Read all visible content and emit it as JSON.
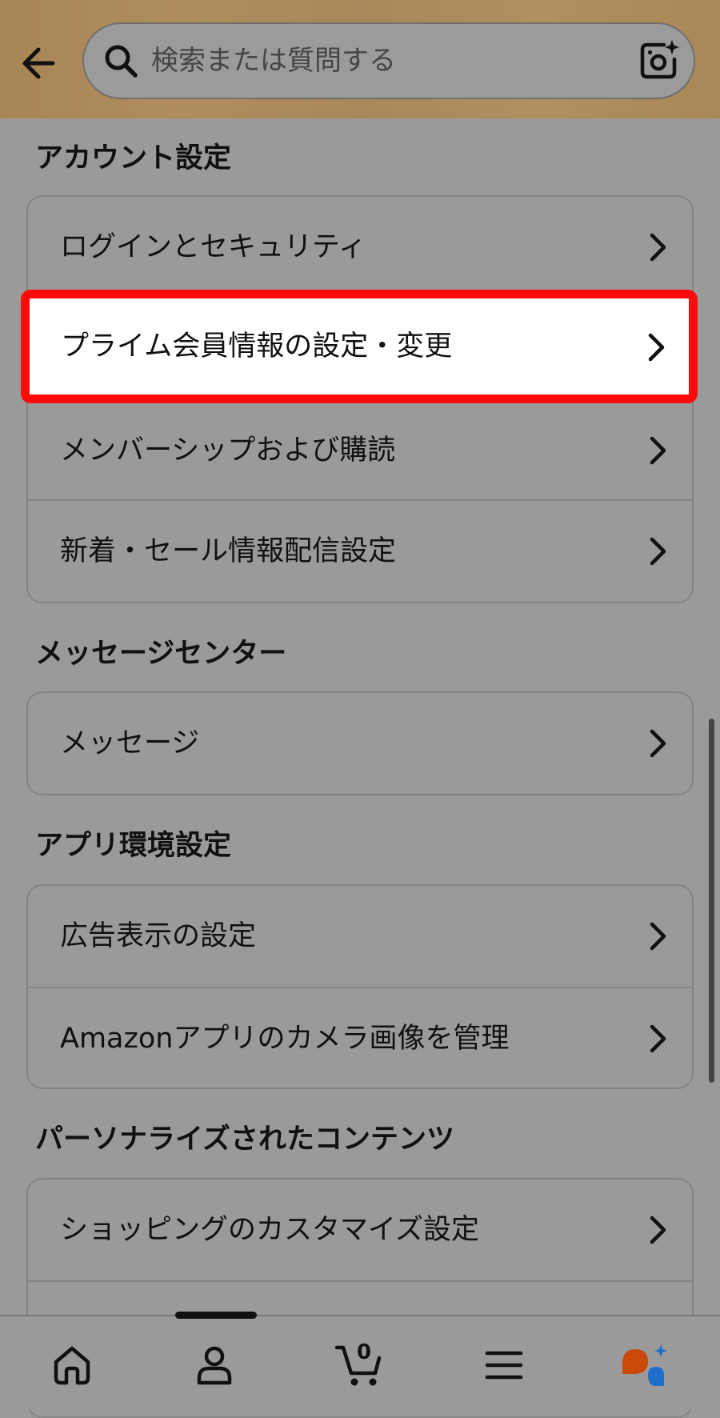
{
  "header": {
    "search": {
      "placeholder": "検索または質問する"
    }
  },
  "sections": [
    {
      "title": "アカウント設定",
      "items": [
        "ログインとセキュリティ",
        "プライム会員情報の設定・変更",
        "メンバーシップおよび購読",
        "新着・セール情報配信設定"
      ]
    },
    {
      "title": "メッセージセンター",
      "items": [
        "メッセージ"
      ]
    },
    {
      "title": "アプリ環境設定",
      "items": [
        "広告表示の設定",
        "Amazonアプリのカメラ画像を管理"
      ]
    },
    {
      "title": "パーソナライズされたコンテンツ",
      "items": [
        "ショッピングのカスタマイズ設定"
      ]
    }
  ],
  "highlight": {
    "item": "プライム会員情報の設定・変更",
    "color": "#ff0a0a"
  },
  "bottom_nav": {
    "cart_count": "0",
    "icons": [
      "home-icon",
      "account-icon",
      "cart-icon",
      "menu-icon",
      "ai-assistant-icon"
    ],
    "colors": {
      "assistant_orange": "#c8490a",
      "assistant_blue": "#1e6fc9"
    }
  }
}
